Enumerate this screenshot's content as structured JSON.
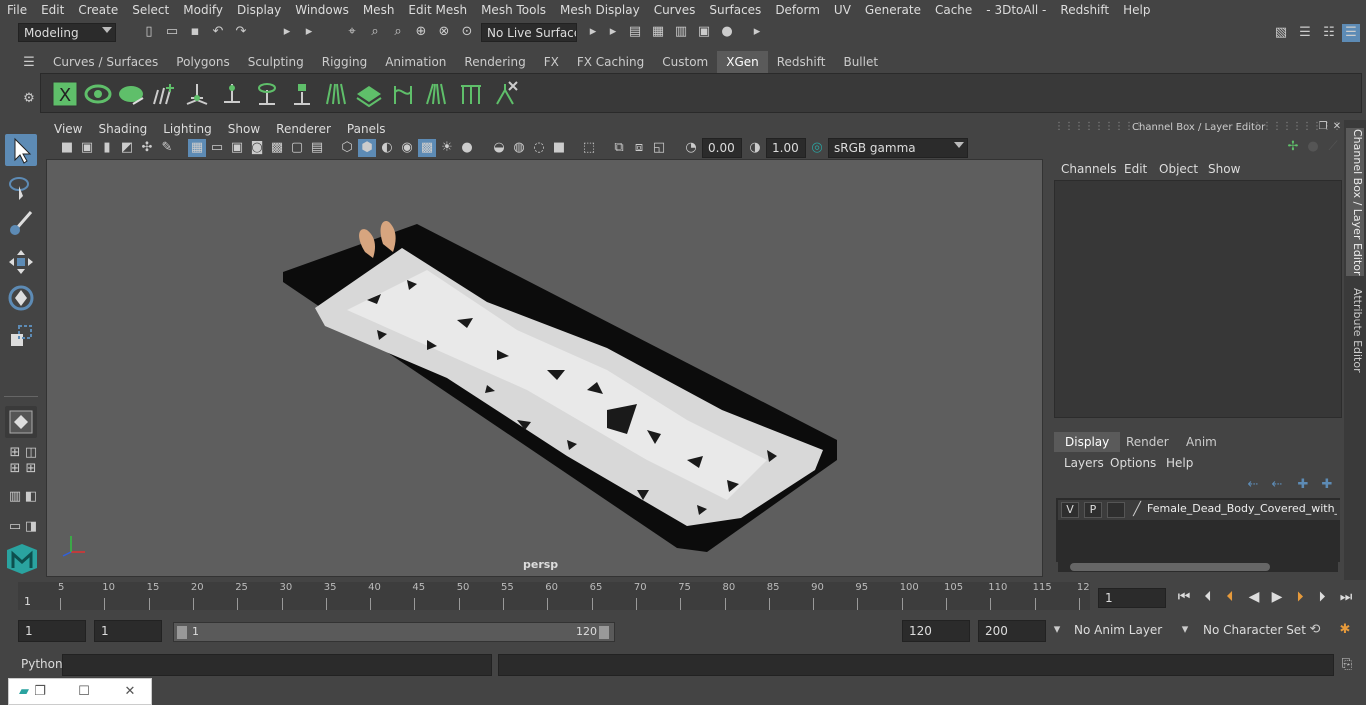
{
  "menubar": [
    "File",
    "Edit",
    "Create",
    "Select",
    "Modify",
    "Display",
    "Windows",
    "Mesh",
    "Edit Mesh",
    "Mesh Tools",
    "Mesh Display",
    "Curves",
    "Surfaces",
    "Deform",
    "UV",
    "Generate",
    "Cache",
    "- 3DtoAll -",
    "Redshift",
    "Help"
  ],
  "status": {
    "mode": "Modeling",
    "live_surface": "No Live Surface"
  },
  "shelf_tabs": [
    "Curves / Surfaces",
    "Polygons",
    "Sculpting",
    "Rigging",
    "Animation",
    "Rendering",
    "FX",
    "FX Caching",
    "Custom",
    "XGen",
    "Redshift",
    "Bullet"
  ],
  "shelf_active": "XGen",
  "view_menu": [
    "View",
    "Shading",
    "Lighting",
    "Show",
    "Renderer",
    "Panels"
  ],
  "view_tools": {
    "exposure": "0.00",
    "gamma": "1.00",
    "color_space": "sRGB gamma"
  },
  "viewport": {
    "camera": "persp"
  },
  "channel_box": {
    "title": "Channel Box / Layer Editor",
    "menu": [
      "Channels",
      "Edit",
      "Object",
      "Show"
    ]
  },
  "layer_editor": {
    "tabs": [
      "Display",
      "Render",
      "Anim"
    ],
    "active_tab": "Display",
    "menu": [
      "Layers",
      "Options",
      "Help"
    ],
    "layer": {
      "v": "V",
      "p": "P",
      "name": "Female_Dead_Body_Covered_with_Cloth"
    }
  },
  "side_tabs": [
    "Channel Box / Layer Editor",
    "Attribute Editor"
  ],
  "timeline": {
    "ticks": [
      "5",
      "10",
      "15",
      "20",
      "25",
      "30",
      "35",
      "40",
      "45",
      "50",
      "55",
      "60",
      "65",
      "70",
      "75",
      "80",
      "85",
      "90",
      "95",
      "100",
      "105",
      "110",
      "115",
      "12"
    ],
    "start_label": "1",
    "current_frame": "1"
  },
  "range": {
    "start": "1",
    "playback_start": "1",
    "slider_start": "1",
    "slider_end": "120",
    "playback_end": "120",
    "end": "200",
    "anim_layer": "No Anim Layer",
    "character_set": "No Character Set"
  },
  "cmdline": {
    "label": "Python"
  },
  "colors": {
    "accent": "#5d8bb5",
    "teal": "#2aa3a0",
    "shelf_green": "#5fbf6a"
  }
}
